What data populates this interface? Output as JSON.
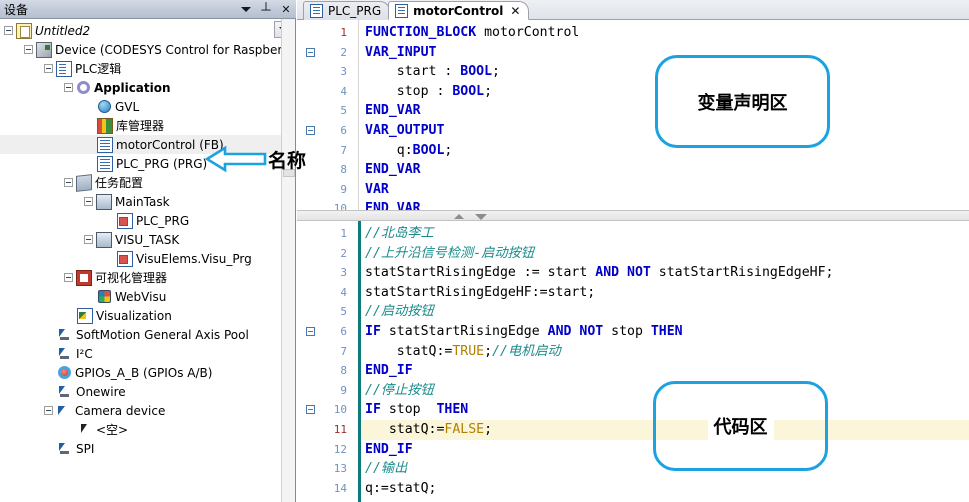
{
  "device_panel": {
    "title": "设备",
    "header_buttons": [
      {
        "name": "dropdown-icon",
        "glyph": "▼"
      },
      {
        "name": "pin-icon",
        "glyph": "╄"
      },
      {
        "name": "close-icon",
        "glyph": "✕"
      }
    ],
    "tree": [
      {
        "label": "Untitled2",
        "indent": 0,
        "expander": true,
        "icon": "project-icon",
        "style": "italic",
        "selected": false
      },
      {
        "label": "Device (CODESYS Control for Raspberry Pi SL)",
        "indent": 1,
        "expander": true,
        "icon": "device-icon",
        "style": "",
        "selected": false
      },
      {
        "label": "PLC逻辑",
        "indent": 2,
        "expander": true,
        "icon": "plc-logic-icon",
        "style": "",
        "selected": false
      },
      {
        "label": "Application",
        "indent": 3,
        "expander": true,
        "icon": "application-icon",
        "style": "bold",
        "selected": false
      },
      {
        "label": "GVL",
        "indent": 4,
        "expander": false,
        "icon": "gvl-icon",
        "style": "",
        "selected": false
      },
      {
        "label": "库管理器",
        "indent": 4,
        "expander": false,
        "icon": "library-manager-icon",
        "style": "",
        "selected": false
      },
      {
        "label": "motorControl (FB)",
        "indent": 4,
        "expander": false,
        "icon": "function-block-icon",
        "style": "",
        "selected": true
      },
      {
        "label": "PLC_PRG (PRG)",
        "indent": 4,
        "expander": false,
        "icon": "program-icon",
        "style": "",
        "selected": false
      },
      {
        "label": "任务配置",
        "indent": 3,
        "expander": true,
        "icon": "task-configuration-icon",
        "style": "",
        "selected": false
      },
      {
        "label": "MainTask",
        "indent": 4,
        "expander": true,
        "icon": "task-icon",
        "style": "",
        "selected": false
      },
      {
        "label": "PLC_PRG",
        "indent": 5,
        "expander": false,
        "icon": "task-program-icon",
        "style": "",
        "selected": false
      },
      {
        "label": "VISU_TASK",
        "indent": 4,
        "expander": true,
        "icon": "task-icon",
        "style": "",
        "selected": false
      },
      {
        "label": "VisuElems.Visu_Prg",
        "indent": 5,
        "expander": false,
        "icon": "task-program-icon",
        "style": "",
        "selected": false
      },
      {
        "label": "可视化管理器",
        "indent": 3,
        "expander": true,
        "icon": "visualization-manager-icon",
        "style": "",
        "selected": false
      },
      {
        "label": "WebVisu",
        "indent": 4,
        "expander": false,
        "icon": "webvisu-icon",
        "style": "",
        "selected": false
      },
      {
        "label": "Visualization",
        "indent": 3,
        "expander": false,
        "icon": "visualization-icon",
        "style": "",
        "selected": false
      },
      {
        "label": "SoftMotion General Axis Pool",
        "indent": 2,
        "expander": false,
        "icon": "axis-pool-icon",
        "style": "",
        "selected": false
      },
      {
        "label": "I²C",
        "indent": 2,
        "expander": false,
        "icon": "axis-pool-icon",
        "style": "",
        "selected": false
      },
      {
        "label": "GPIOs_A_B (GPIOs A/B)",
        "indent": 2,
        "expander": false,
        "icon": "gpio-icon",
        "style": "",
        "selected": false
      },
      {
        "label": "Onewire",
        "indent": 2,
        "expander": false,
        "icon": "axis-pool-icon",
        "style": "",
        "selected": false
      },
      {
        "label": "Camera device",
        "indent": 2,
        "expander": true,
        "icon": "camera-icon",
        "style": "",
        "selected": false
      },
      {
        "label": "<空>",
        "indent": 3,
        "expander": false,
        "icon": "empty-slot-icon",
        "style": "",
        "selected": false
      },
      {
        "label": "SPI",
        "indent": 2,
        "expander": false,
        "icon": "axis-pool-icon",
        "style": "",
        "selected": false
      }
    ]
  },
  "editor": {
    "tabs": [
      {
        "label": "PLC_PRG",
        "active": false,
        "closable": false
      },
      {
        "label": "motorControl",
        "active": true,
        "closable": true,
        "close_glyph": "✕"
      }
    ],
    "declaration": {
      "lines": [
        {
          "n": "1",
          "modified": true,
          "fold": false,
          "segments": [
            {
              "t": "FUNCTION_BLOCK ",
              "c": "kw"
            },
            {
              "t": "motorControl",
              "c": ""
            }
          ]
        },
        {
          "n": "2",
          "modified": false,
          "fold": true,
          "segments": [
            {
              "t": "VAR_INPUT",
              "c": "kw"
            }
          ]
        },
        {
          "n": "3",
          "modified": false,
          "fold": false,
          "segments": [
            {
              "t": "    start : ",
              "c": ""
            },
            {
              "t": "BOOL",
              "c": "kw"
            },
            {
              "t": ";",
              "c": ""
            }
          ]
        },
        {
          "n": "4",
          "modified": false,
          "fold": false,
          "segments": [
            {
              "t": "    stop : ",
              "c": ""
            },
            {
              "t": "BOOL",
              "c": "kw"
            },
            {
              "t": ";",
              "c": ""
            }
          ]
        },
        {
          "n": "5",
          "modified": false,
          "fold": false,
          "segments": [
            {
              "t": "END_VAR",
              "c": "kw"
            }
          ]
        },
        {
          "n": "6",
          "modified": false,
          "fold": true,
          "segments": [
            {
              "t": "VAR_OUTPUT",
              "c": "kw"
            }
          ]
        },
        {
          "n": "7",
          "modified": false,
          "fold": false,
          "segments": [
            {
              "t": "    q:",
              "c": ""
            },
            {
              "t": "BOOL",
              "c": "kw"
            },
            {
              "t": ";",
              "c": ""
            }
          ]
        },
        {
          "n": "8",
          "modified": false,
          "fold": false,
          "segments": [
            {
              "t": "END_VAR",
              "c": "kw"
            }
          ]
        },
        {
          "n": "9",
          "modified": false,
          "fold": false,
          "segments": [
            {
              "t": "VAR",
              "c": "kw"
            }
          ]
        },
        {
          "n": "10",
          "modified": false,
          "fold": false,
          "segments": [
            {
              "t": "END_VAR",
              "c": "kw"
            }
          ]
        }
      ]
    },
    "implementation": {
      "highlight_line": 11,
      "lines": [
        {
          "n": "1",
          "modified": false,
          "fold": false,
          "segments": [
            {
              "t": "//北岛李工",
              "c": "cmt"
            }
          ]
        },
        {
          "n": "2",
          "modified": false,
          "fold": false,
          "segments": [
            {
              "t": "//上升沿信号检测-启动按钮",
              "c": "cmt"
            }
          ]
        },
        {
          "n": "3",
          "modified": false,
          "fold": false,
          "segments": [
            {
              "t": "statStartRisingEdge := start ",
              "c": ""
            },
            {
              "t": "AND NOT ",
              "c": "kw"
            },
            {
              "t": "statStartRisingEdgeHF;",
              "c": ""
            }
          ]
        },
        {
          "n": "4",
          "modified": false,
          "fold": false,
          "segments": [
            {
              "t": "statStartRisingEdgeHF:=start;",
              "c": ""
            }
          ]
        },
        {
          "n": "5",
          "modified": false,
          "fold": false,
          "segments": [
            {
              "t": "//启动按钮",
              "c": "cmt"
            }
          ]
        },
        {
          "n": "6",
          "modified": false,
          "fold": true,
          "segments": [
            {
              "t": "IF ",
              "c": "kw"
            },
            {
              "t": "statStartRisingEdge ",
              "c": ""
            },
            {
              "t": "AND NOT ",
              "c": "kw"
            },
            {
              "t": "stop ",
              "c": ""
            },
            {
              "t": "THEN",
              "c": "kw"
            }
          ]
        },
        {
          "n": "7",
          "modified": false,
          "fold": false,
          "segments": [
            {
              "t": "    statQ:=",
              "c": ""
            },
            {
              "t": "TRUE",
              "c": "lit"
            },
            {
              "t": ";",
              "c": ""
            },
            {
              "t": "//电机启动",
              "c": "cmt"
            }
          ]
        },
        {
          "n": "8",
          "modified": false,
          "fold": false,
          "segments": [
            {
              "t": "END_IF",
              "c": "kw"
            }
          ]
        },
        {
          "n": "9",
          "modified": false,
          "fold": false,
          "segments": [
            {
              "t": "//停止按钮",
              "c": "cmt"
            }
          ]
        },
        {
          "n": "10",
          "modified": false,
          "fold": true,
          "segments": [
            {
              "t": "IF ",
              "c": "kw"
            },
            {
              "t": "stop  ",
              "c": ""
            },
            {
              "t": "THEN",
              "c": "kw"
            }
          ]
        },
        {
          "n": "11",
          "modified": true,
          "fold": false,
          "segments": [
            {
              "t": "   statQ:=",
              "c": ""
            },
            {
              "t": "FALSE",
              "c": "lit"
            },
            {
              "t": ";",
              "c": ""
            }
          ]
        },
        {
          "n": "12",
          "modified": false,
          "fold": false,
          "segments": [
            {
              "t": "END_IF",
              "c": "kw"
            }
          ]
        },
        {
          "n": "13",
          "modified": false,
          "fold": false,
          "segments": [
            {
              "t": "//输出",
              "c": "cmt"
            }
          ]
        },
        {
          "n": "14",
          "modified": false,
          "fold": false,
          "segments": [
            {
              "t": "q:=statQ;",
              "c": ""
            }
          ]
        }
      ]
    }
  },
  "annotations": {
    "callout_declaration": "变量声明区",
    "callout_code": "代码区",
    "arrow_label": "名称",
    "accent_color": "#1ca2e0"
  }
}
